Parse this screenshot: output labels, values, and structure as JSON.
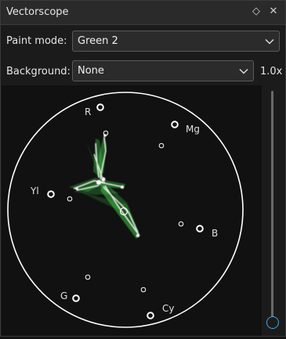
{
  "window": {
    "title": "Vectorscope"
  },
  "paint_mode": {
    "label": "Paint mode:",
    "value": "Green 2"
  },
  "background": {
    "label": "Background:",
    "value": "None"
  },
  "zoom": {
    "value": "1.0x"
  },
  "scope": {
    "targets": [
      "R",
      "Mg",
      "Yl",
      "B",
      "G",
      "Cy"
    ],
    "trace_color": "#3fd14a",
    "circle_color": "#ffffff"
  }
}
